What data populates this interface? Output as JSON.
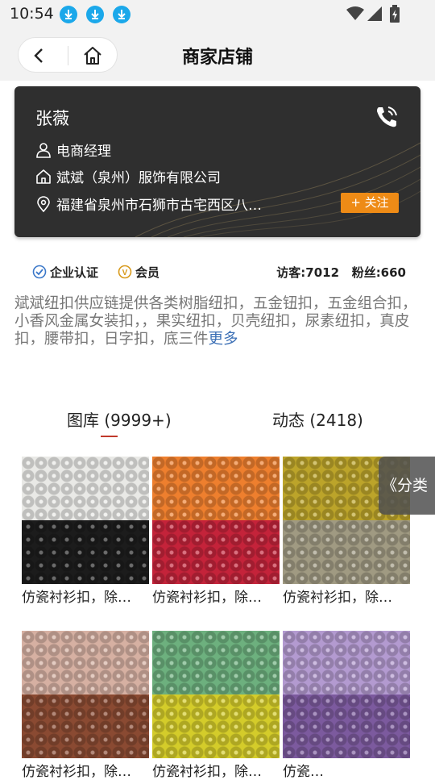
{
  "status": {
    "time": "10:54"
  },
  "header": {
    "title": "商家店铺"
  },
  "card": {
    "name": "张薇",
    "position": "电商经理",
    "company": "斌斌（泉州）服饰有限公司",
    "address": "福建省泉州市石狮市古宅西区八…",
    "follow_label": "+ 关注"
  },
  "badges": {
    "enterprise": "企业认证",
    "member": "会员",
    "member_icon_letter": "V"
  },
  "stats": {
    "visitors": "访客:7012",
    "fans": "粉丝:660"
  },
  "description": {
    "text": "斌斌纽扣供应链提供各类树脂纽扣，五金钮扣，五金组合扣，小香风金属女装扣，，果实纽扣，贝壳纽扣，尿素纽扣，真皮扣，腰带扣，日字扣，底三件",
    "more": "更多"
  },
  "tabs": [
    {
      "label": "图库 (9999+)"
    },
    {
      "label": "动态 (2418)"
    }
  ],
  "float_button": {
    "label": "《分类"
  },
  "products": [
    {
      "caption": "仿瓷衬衫扣，除…",
      "top_color": "#e9e9e6",
      "bottom_color": "#1c1c1c"
    },
    {
      "caption": "仿瓷衬衫扣，除…",
      "top_color": "#ee7f2e",
      "bottom_color": "#c4233a"
    },
    {
      "caption": "仿瓷衬衫扣，除…",
      "top_color": "#bca42a",
      "bottom_color": "#a09a82"
    },
    {
      "caption": "仿瓷衬衫扣，除…",
      "top_color": "#d6b0a2",
      "bottom_color": "#8a4a32"
    },
    {
      "caption": "仿瓷衬衫扣，除…",
      "top_color": "#6db07e",
      "bottom_color": "#d4cc2a"
    },
    {
      "caption": "仿瓷…",
      "top_color": "#b39ad0",
      "bottom_color": "#7c5a9e"
    }
  ],
  "colors": {
    "accent_orange": "#ee8b16",
    "link_blue": "#3b6fb5",
    "download_blue": "#1ba8ea",
    "tab_underline": "#c0392b"
  }
}
